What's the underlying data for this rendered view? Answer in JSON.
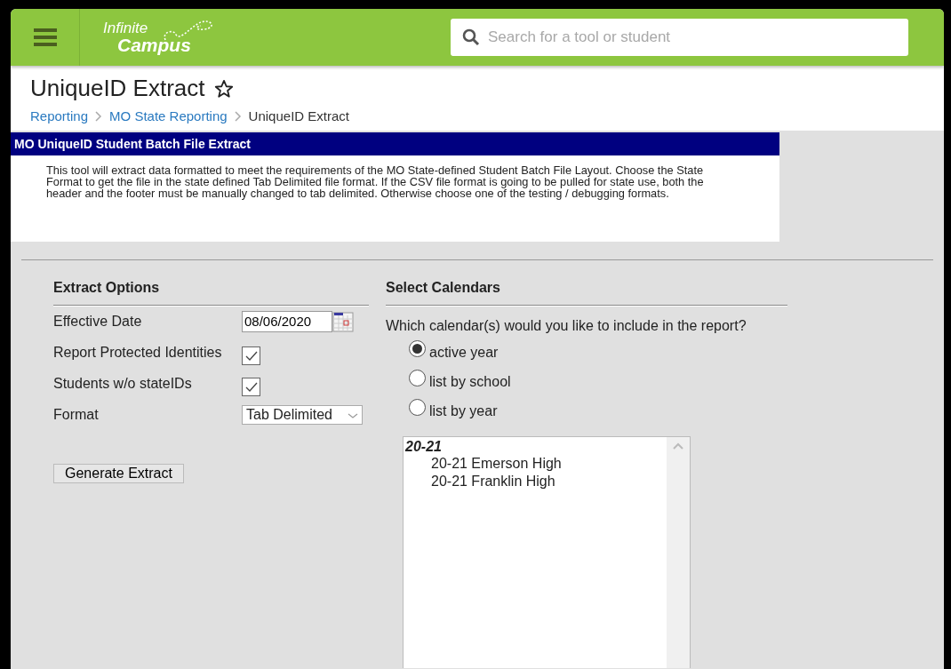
{
  "header": {
    "logo": {
      "line_1": "Infinite",
      "line_2": "Campus"
    },
    "search": {
      "placeholder": "Search for a tool or student"
    }
  },
  "page": {
    "title": "UniqueID Extract",
    "favorite": false,
    "breadcrumbs": [
      {
        "label": "Reporting",
        "link": true
      },
      {
        "label": "MO State Reporting",
        "link": true
      },
      {
        "label": "UniqueID Extract",
        "link": false
      }
    ]
  },
  "info_panel": {
    "title": "MO UniqueID Student Batch File Extract",
    "description": "This tool will extract data formatted to meet the requirements of the MO State-defined Student Batch File Layout. Choose the State Format to get the file in the state defined Tab Delimited file format. If the CSV file format is going to be pulled for state use, both the header and the footer must be manually changed to tab delimited. Otherwise choose one of the testing / debugging formats."
  },
  "extract_options": {
    "heading": "Extract Options",
    "fields": [
      {
        "kind": "date",
        "label": "Effective Date",
        "value": "08/06/2020"
      },
      {
        "kind": "checkbox",
        "label": "Report Protected Identities",
        "checked": true
      },
      {
        "kind": "checkbox",
        "label": "Students w/o stateIDs",
        "checked": true
      },
      {
        "kind": "select",
        "label": "Format",
        "value": "Tab Delimited"
      }
    ],
    "button": "Generate Extract"
  },
  "select_calendars": {
    "heading": "Select Calendars",
    "question": "Which calendar(s) would you like to include in the report?",
    "options": [
      {
        "label": "active year",
        "selected": true
      },
      {
        "label": "list by school",
        "selected": false
      },
      {
        "label": "list by year",
        "selected": false
      }
    ],
    "calendar_list": [
      {
        "label": "20-21",
        "children": [
          {
            "label": "20-21 Emerson High"
          },
          {
            "label": "20-21 Franklin High"
          }
        ]
      }
    ]
  }
}
